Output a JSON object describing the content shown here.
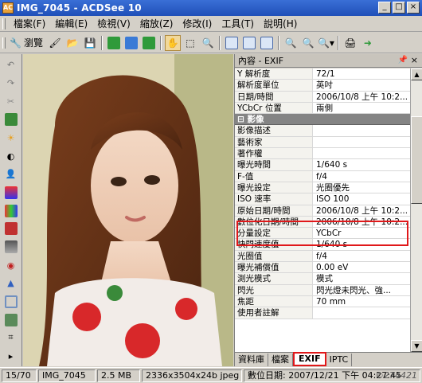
{
  "window": {
    "title": "IMG_7045 - ACDSee 10",
    "app_icon": "acdsee-icon",
    "buttons": [
      "_",
      "□",
      "×"
    ]
  },
  "menu": [
    "檔案(F)",
    "編輯(E)",
    "檢視(V)",
    "縮放(Z)",
    "修改(I)",
    "工具(T)",
    "說明(H)"
  ],
  "toolbar": {
    "browse_label": "瀏覽"
  },
  "panel": {
    "title": "內容 - EXIF",
    "rows": [
      {
        "k": "Y 解析度",
        "v": "72/1"
      },
      {
        "k": "解析度單位",
        "v": "英吋"
      },
      {
        "k": "日期/時間",
        "v": "2006/10/8 上午 10:2..."
      },
      {
        "k": "YCbCr 位置",
        "v": "兩側"
      },
      {
        "k": "⊟ 影像",
        "v": "",
        "group": true
      },
      {
        "k": "影像描述",
        "v": ""
      },
      {
        "k": "藝術家",
        "v": ""
      },
      {
        "k": "著作權",
        "v": ""
      },
      {
        "k": "曝光時間",
        "v": "1/640 s"
      },
      {
        "k": "F-值",
        "v": "f/4"
      },
      {
        "k": "曝光設定",
        "v": "光圈優先"
      },
      {
        "k": "ISO 速率",
        "v": "ISO 100"
      },
      {
        "k": "原始日期/時間",
        "v": "2006/10/8 上午 10:2..."
      },
      {
        "k": "數位化日期/時間",
        "v": "2006/10/8 上午 10:2..."
      },
      {
        "k": "分量設定",
        "v": "YCbCr"
      },
      {
        "k": "快門速度值",
        "v": "1/640 s"
      },
      {
        "k": "光圈值",
        "v": "f/4"
      },
      {
        "k": "曝光補償值",
        "v": "0.00 eV"
      },
      {
        "k": "測光模式",
        "v": "模式"
      },
      {
        "k": "閃光",
        "v": "閃光燈未閃光、強..."
      },
      {
        "k": "焦距",
        "v": "70 mm"
      },
      {
        "k": "使用者註解",
        "v": ""
      }
    ],
    "tabs": [
      "資料庫",
      "檔案",
      "EXIF",
      "IPTC"
    ],
    "active_tab": "EXIF"
  },
  "status": {
    "index": "15/70",
    "name": "IMG_7045",
    "size": "2.5 MB",
    "dims": "2336x3504x24b jpeg",
    "date": "數位日期: 2007/12/21 下午 04:27:45",
    "watermark": "©274421"
  },
  "colors": {
    "accent_red": "#e0181a",
    "title_blue": "#1f4fb8"
  }
}
